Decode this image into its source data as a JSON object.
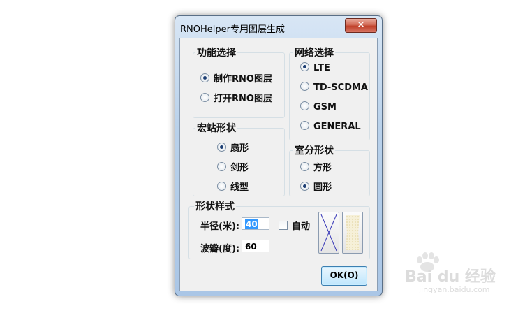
{
  "window": {
    "title": "RNOHelper专用图层生成",
    "close_glyph": "✕"
  },
  "function_group": {
    "legend": "功能选择",
    "options": [
      {
        "label": "制作RNO图层",
        "selected": true
      },
      {
        "label": "打开RNO图层",
        "selected": false
      }
    ]
  },
  "network_group": {
    "legend": "网络选择",
    "options": [
      {
        "label": "LTE",
        "selected": true
      },
      {
        "label": "TD-SCDMA",
        "selected": false
      },
      {
        "label": "GSM",
        "selected": false
      },
      {
        "label": "GENERAL",
        "selected": false
      }
    ]
  },
  "macro_group": {
    "legend": "宏站形状",
    "options": [
      {
        "label": "扇形",
        "selected": true
      },
      {
        "label": "剑形",
        "selected": false
      },
      {
        "label": "线型",
        "selected": false
      }
    ]
  },
  "indoor_group": {
    "legend": "室分形状",
    "options": [
      {
        "label": "方形",
        "selected": false
      },
      {
        "label": "圆形",
        "selected": true
      }
    ]
  },
  "style_group": {
    "legend": "形状样式",
    "radius_label": "半径(米):",
    "radius_value": "40",
    "auto_label": "自动",
    "auto_checked": false,
    "beam_label": "波瓣(度):",
    "beam_value": "60",
    "line_color": "#3a3ab8"
  },
  "ok_button": {
    "label": "OK(O)"
  },
  "watermark": {
    "brand": "Bai du 经验",
    "url": "jingyan.baidu.com"
  }
}
